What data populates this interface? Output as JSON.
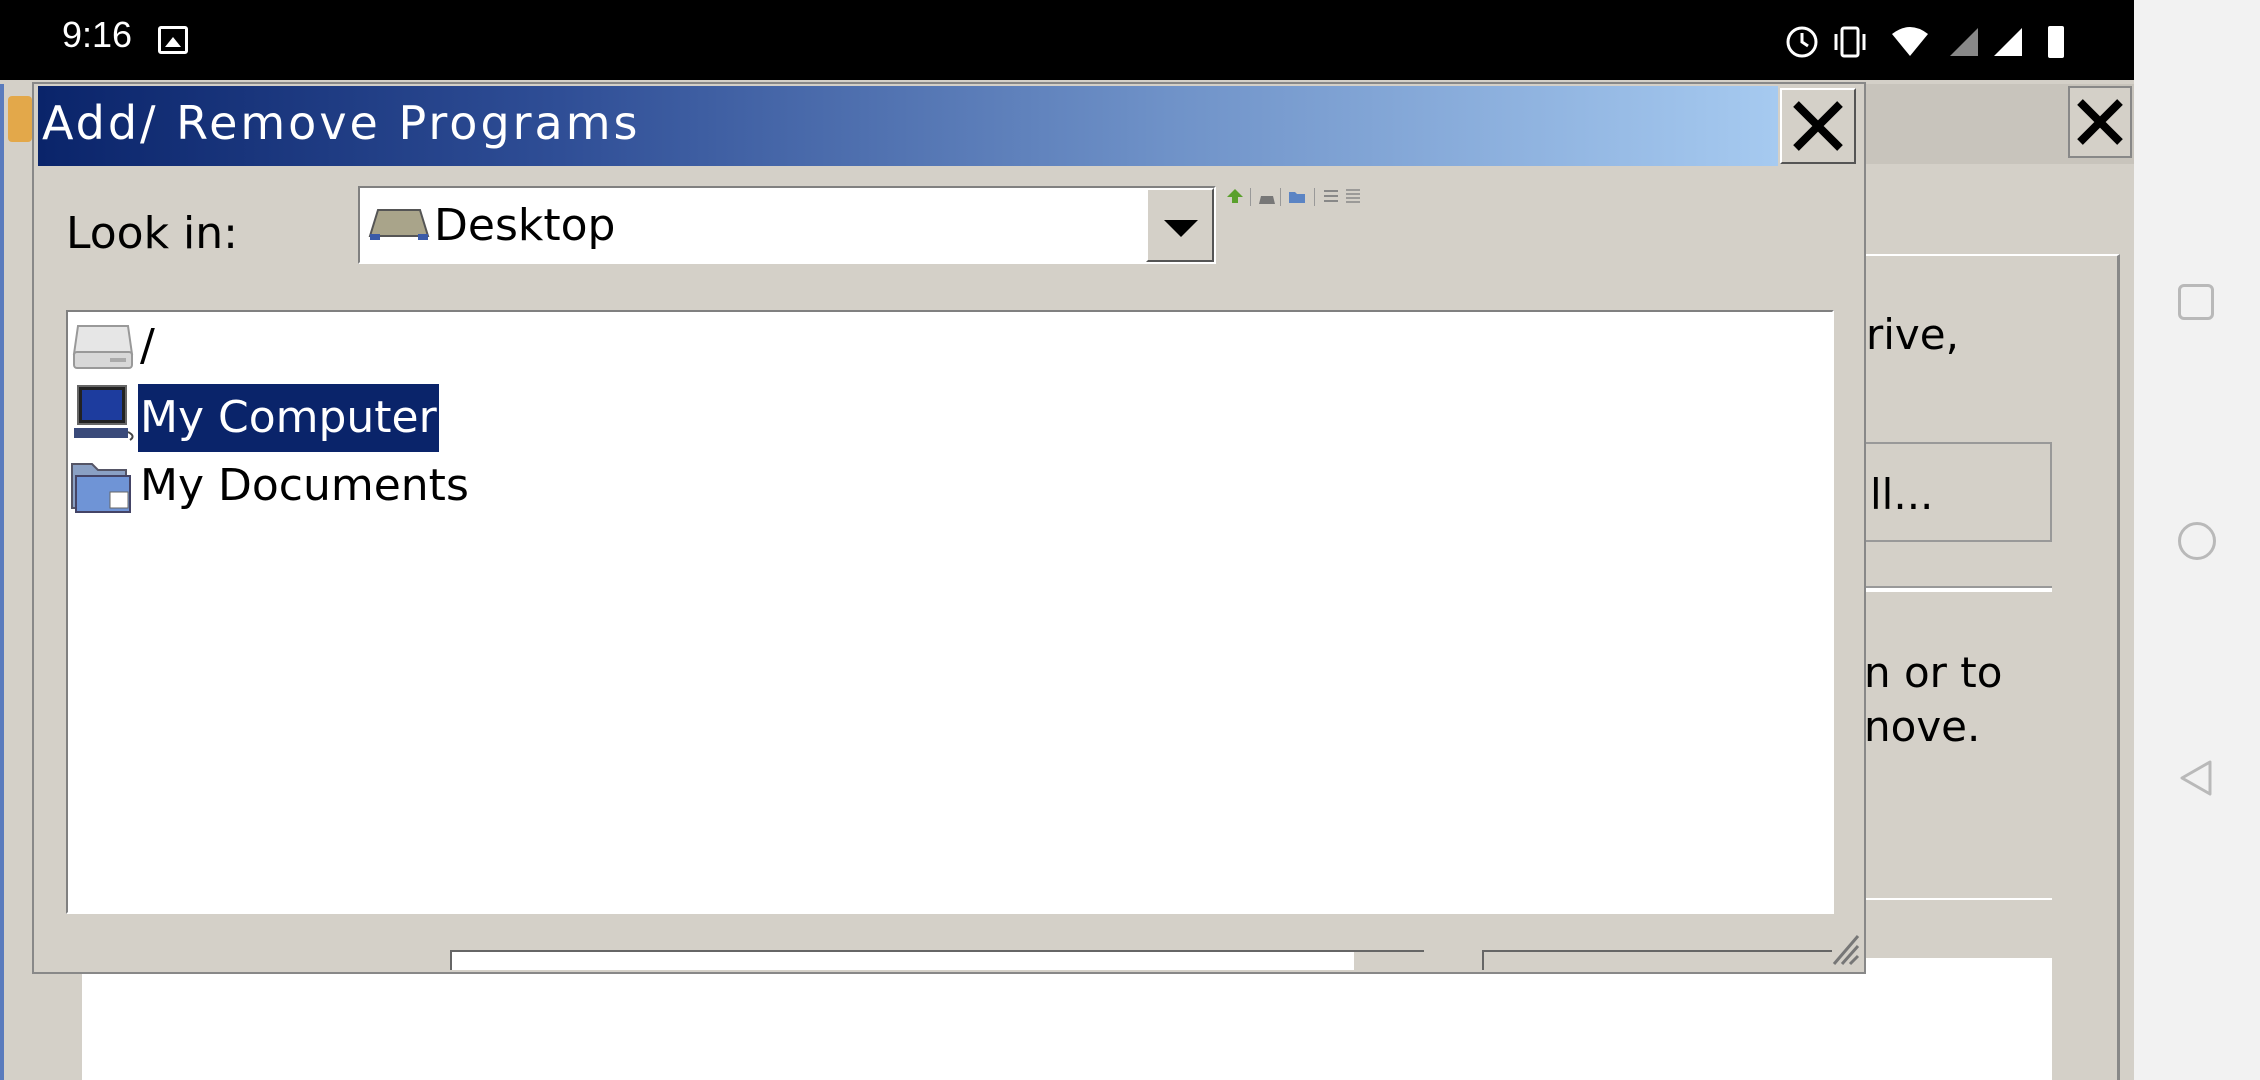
{
  "status_bar": {
    "time": "9:16",
    "icons": [
      "image-notification-icon",
      "alarm-icon",
      "vibrate-icon",
      "wifi-icon",
      "signal-icon",
      "signal-icon",
      "battery-icon"
    ]
  },
  "background_window": {
    "texts": [
      "rive,",
      "ll...",
      "n or to",
      "nove."
    ]
  },
  "dialog": {
    "title": "Add/ Remove Programs",
    "close_label": "✕",
    "look_in_label": "Look in:",
    "look_in_value": "Desktop",
    "toolbar": [
      "up-folder-icon",
      "desktop-icon",
      "new-folder-icon",
      "list-view-icon",
      "details-view-icon"
    ],
    "items": [
      {
        "label": "/",
        "icon": "drive-icon"
      },
      {
        "label": "My Computer",
        "icon": "computer-icon",
        "selected": true
      },
      {
        "label": "My Documents",
        "icon": "folder-icon"
      }
    ]
  },
  "colors": {
    "title_start": "#0a246a",
    "title_end": "#a6caf0",
    "selection": "#0a246a",
    "window_bg": "#d4d0c8"
  }
}
